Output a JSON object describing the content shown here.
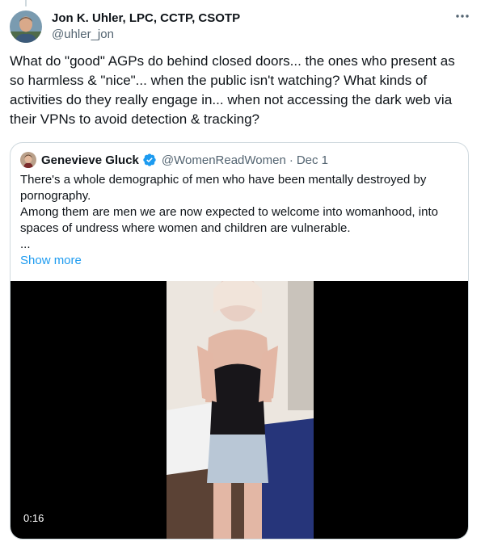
{
  "tweet": {
    "author_name": "Jon K. Uhler, LPC, CCTP, CSOTP",
    "author_handle": "@uhler_jon",
    "more_icon": "more-horizontal-icon",
    "text_lines": [
      "What do \"good\" AGPs do behind closed doors... the ones who present as",
      "so harmless & \"nice\"... when the public isn't watching? What kinds of",
      "activities do they really engage in... when not accessing the dark web via",
      "their VPNs to avoid detection & tracking?"
    ]
  },
  "quote": {
    "author_name": "Genevieve Gluck",
    "verified_icon": "verified-badge-icon",
    "author_handle": "@WomenReadWomen",
    "separator": "·",
    "date": "Dec 1",
    "text_lines": [
      "There's a whole demographic of men who have been mentally destroyed by",
      "pornography.",
      "Among them are men we are now expected to welcome into womanhood, into",
      "spaces of undress where women and children are vulnerable.",
      "..."
    ],
    "show_more_label": "Show more",
    "video": {
      "duration": "0:16"
    }
  },
  "colors": {
    "text_primary": "#0f1419",
    "text_secondary": "#536471",
    "accent": "#1d9bf0",
    "border": "#cfd9de"
  }
}
